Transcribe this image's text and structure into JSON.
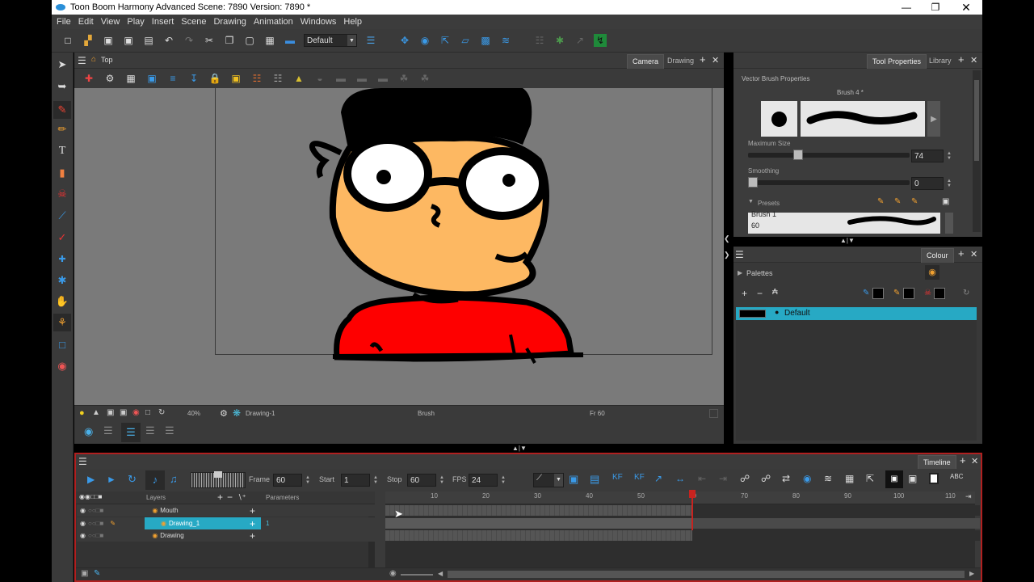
{
  "window": {
    "title": "Toon Boom Harmony Advanced Scene: 7890 Version: 7890 *"
  },
  "menu": [
    "File",
    "Edit",
    "View",
    "Play",
    "Insert",
    "Scene",
    "Drawing",
    "Animation",
    "Windows",
    "Help"
  ],
  "toolbar": {
    "workspace": "Default"
  },
  "camera_view": {
    "breadcrumb": "Top",
    "tabs": [
      "Camera",
      "Drawing"
    ],
    "status": {
      "zoom": "40%",
      "drawing": "Drawing-1",
      "tool": "Brush",
      "frame": "Fr 60"
    }
  },
  "tool_properties": {
    "tabs": [
      "Tool Properties",
      "Library"
    ],
    "section": "Vector Brush Properties",
    "brush_name": "Brush 4 *",
    "max_size_label": "Maximum Size",
    "max_size_value": "74",
    "max_size": 0.3,
    "smoothing_label": "Smoothing",
    "smoothing_value": "0",
    "smoothing": 0.0,
    "presets_label": "Presets",
    "preset_name": "Brush 1",
    "preset_size": "60"
  },
  "colour": {
    "tab": "Colour",
    "palettes_label": "Palettes",
    "palette_name": "Default"
  },
  "timeline": {
    "tab": "Timeline",
    "frame_label": "Frame",
    "frame_value": "60",
    "start_label": "Start",
    "start_value": "1",
    "stop_label": "Stop",
    "stop_value": "60",
    "fps_label": "FPS",
    "fps_value": "24",
    "layers_header": "Layers",
    "params_header": "Parameters",
    "layers": [
      {
        "name": "Mouth",
        "selected": false,
        "param": ""
      },
      {
        "name": "Drawing_1",
        "selected": true,
        "param": "1"
      },
      {
        "name": "Drawing",
        "selected": false,
        "param": ""
      }
    ],
    "ruler": [
      "10",
      "20",
      "30",
      "40",
      "50",
      "60",
      "70",
      "80",
      "90",
      "100",
      "110"
    ],
    "current_frame": 60
  },
  "colors": {
    "accent": "#27a9c4",
    "playhead": "#c8231f",
    "skin": "#fdb862",
    "shirt": "#fe0000"
  }
}
